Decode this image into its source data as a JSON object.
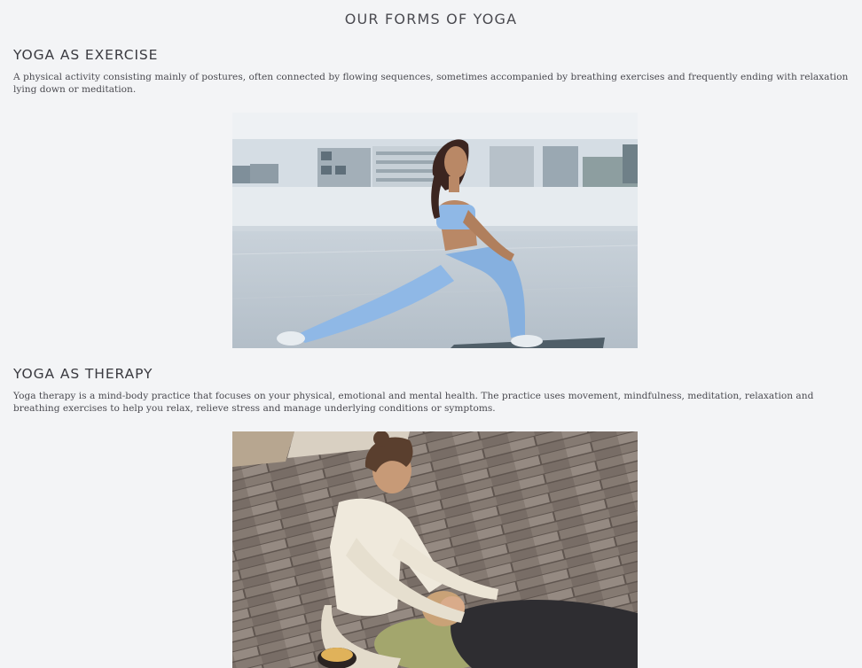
{
  "page": {
    "title": "OUR FORMS OF YOGA"
  },
  "sections": [
    {
      "heading": "YOGA AS EXERCISE",
      "text": "A physical activity consisting mainly of postures, often connected by flowing sequences, sometimes accompanied by breathing exercises and frequently ending with relaxation lying down or meditation."
    },
    {
      "heading": "YOGA AS THERAPY",
      "text": "Yoga therapy is a mind-body practice that focuses on your physical, emotional and mental health. The practice uses movement, mindfulness, meditation, relaxation and breathing exercises to help you relax, relieve stress and manage underlying conditions or symptoms."
    }
  ],
  "colors": {
    "background": "#f3f4f6",
    "text": "#3e3e44",
    "legwear": "#8fb8e6",
    "sweater": "#efe9dc"
  }
}
